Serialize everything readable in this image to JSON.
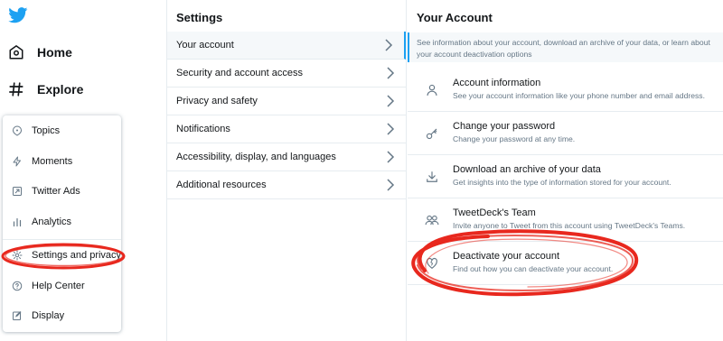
{
  "nav": {
    "home_label": "Home",
    "explore_label": "Explore",
    "menu": [
      {
        "label": "Topics",
        "icon": "topics-icon"
      },
      {
        "label": "Moments",
        "icon": "moments-icon"
      },
      {
        "label": "Twitter Ads",
        "icon": "twitter-ads-icon"
      },
      {
        "label": "Analytics",
        "icon": "analytics-icon"
      },
      {
        "label": "Settings and privacy",
        "icon": "gear-icon"
      },
      {
        "label": "Help Center",
        "icon": "help-icon"
      },
      {
        "label": "Display",
        "icon": "display-icon"
      }
    ]
  },
  "settings": {
    "title": "Settings",
    "items": [
      {
        "label": "Your account",
        "active": true
      },
      {
        "label": "Security and account access"
      },
      {
        "label": "Privacy and safety"
      },
      {
        "label": "Notifications"
      },
      {
        "label": "Accessibility, display, and languages"
      },
      {
        "label": "Additional resources"
      }
    ]
  },
  "account": {
    "title": "Your Account",
    "intro": "See information about your account, download an archive of your data, or learn about your account deactivation options",
    "items": [
      {
        "title": "Account information",
        "desc": "See your account information like your phone number and email address.",
        "icon": "person-icon"
      },
      {
        "title": "Change your password",
        "desc": "Change your password at any time.",
        "icon": "key-icon"
      },
      {
        "title": "Download an archive of your data",
        "desc": "Get insights into the type of information stored for your account.",
        "icon": "download-icon"
      },
      {
        "title": "TweetDeck's Team",
        "desc": "Invite anyone to Tweet from this account using TweetDeck's Teams.",
        "icon": "team-icon"
      },
      {
        "title": "Deactivate your account",
        "desc": "Find out how you can deactivate your account.",
        "icon": "broken-heart-icon"
      }
    ]
  },
  "colors": {
    "accent": "#1da1f2",
    "text": "#14171a",
    "secondary_text": "#657786",
    "border": "#e6ecf0",
    "annotation_red": "#e8281e"
  }
}
